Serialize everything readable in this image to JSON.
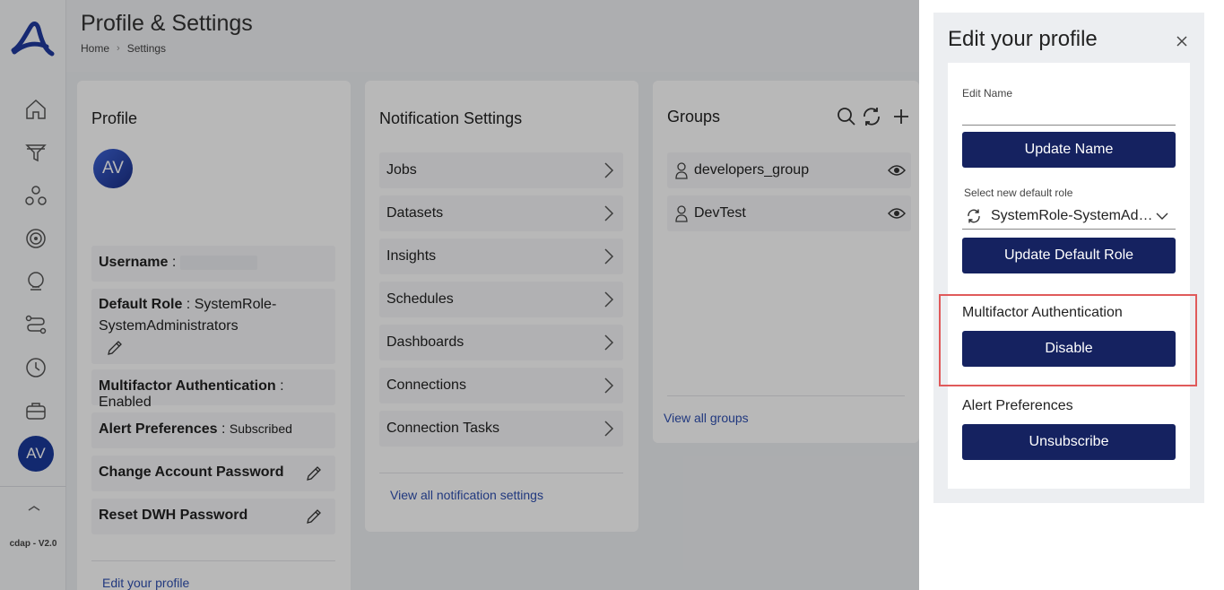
{
  "app": {
    "version": "cdap - V2.0",
    "avatar_initials": "AV"
  },
  "header": {
    "title": "Profile & Settings",
    "breadcrumb": [
      "Home",
      "Settings"
    ]
  },
  "profile": {
    "title": "Profile",
    "avatar": "AV",
    "username_label": "Username",
    "username_value": "",
    "default_role_label": "Default Role",
    "default_role_value_1": "SystemRole-",
    "default_role_value_2": "SystemAdministrators",
    "mfa_label": "Multifactor Authentication",
    "mfa_value": "Enabled",
    "alerts_label": "Alert Preferences",
    "alerts_value": "Subscribed",
    "change_password": "Change Account Password",
    "reset_dwh": "Reset DWH Password",
    "edit_link": "Edit your profile",
    "sep": " : "
  },
  "notifications": {
    "title": "Notification Settings",
    "items": [
      "Jobs",
      "Datasets",
      "Insights",
      "Schedules",
      "Dashboards",
      "Connections",
      "Connection Tasks"
    ],
    "view_all": "View all notification settings"
  },
  "groups": {
    "title": "Groups",
    "items": [
      "developers_group",
      "DevTest"
    ],
    "view_all": "View all groups"
  },
  "drawer": {
    "title": "Edit your profile",
    "edit_name_label": "Edit Name",
    "edit_name_value": "",
    "update_name": "Update Name",
    "role_label": "Select new default role",
    "role_value": "SystemRole-SystemAdministrators",
    "update_role": "Update Default Role",
    "mfa_title": "Multifactor Authentication",
    "mfa_button": "Disable",
    "alerts_title": "Alert Preferences",
    "alerts_button": "Unsubscribe"
  },
  "colors": {
    "primary_button": "#152260",
    "link": "#2f4fb0",
    "highlight": "#e05a5a",
    "avatar": "#1a3a9a"
  }
}
